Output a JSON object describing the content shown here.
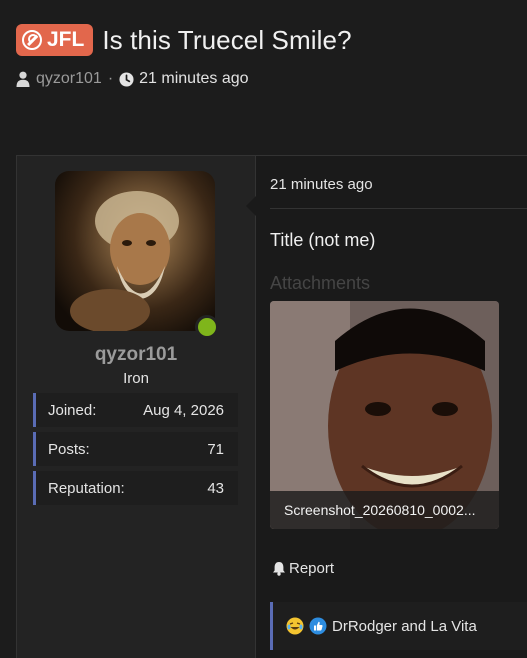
{
  "thread": {
    "prefix": "JFL",
    "title": "Is this Truecel Smile?",
    "author": "qyzor101",
    "separator": "·",
    "time": "21 minutes ago"
  },
  "user": {
    "name": "qyzor101",
    "rank": "Iron",
    "stats": [
      {
        "label": "Joined:",
        "value": "Aug 4, 2026"
      },
      {
        "label": "Posts:",
        "value": "71"
      },
      {
        "label": "Reputation:",
        "value": "43"
      }
    ]
  },
  "post": {
    "time": "21 minutes ago",
    "body": "Title (not me)",
    "attachments_heading": "Attachments",
    "attachment_caption": "Screenshot_20260810_0002...",
    "report_label": "Report",
    "reactions_text": "DrRodger and La Vita"
  },
  "colors": {
    "prefix_badge": "#e2674c",
    "accent_bar": "#5a6cb5",
    "online": "#7fb51b"
  }
}
